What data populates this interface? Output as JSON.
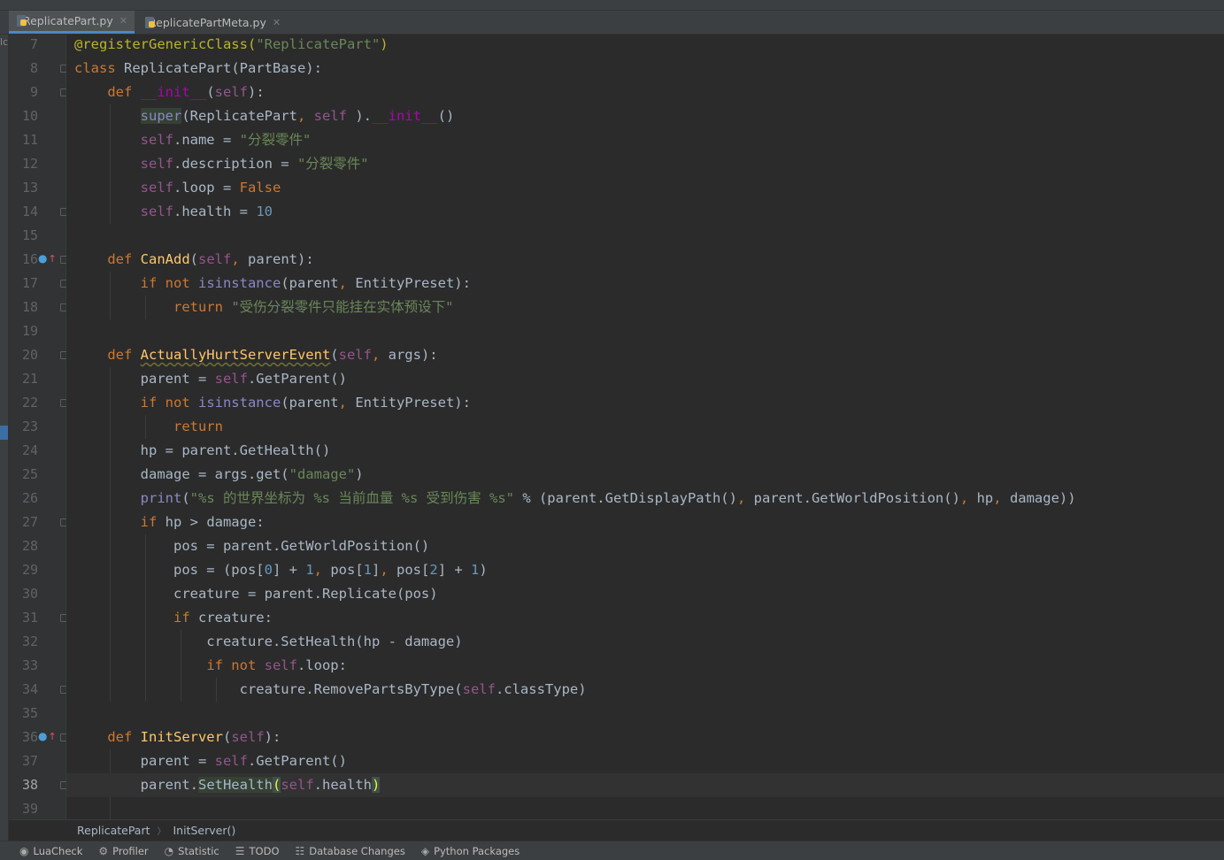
{
  "tabs": [
    {
      "label": "ReplicatePart.py",
      "active": true
    },
    {
      "label": "ReplicatePartMeta.py",
      "active": false
    }
  ],
  "left_strip_label": "lc",
  "breadcrumb": [
    "ReplicatePart",
    "InitServer()"
  ],
  "status_items": [
    {
      "label": "LuaCheck",
      "icon": "luacheck-icon"
    },
    {
      "label": "Profiler",
      "icon": "profiler-icon"
    },
    {
      "label": "Statistic",
      "icon": "statistic-icon"
    },
    {
      "label": "TODO",
      "icon": "todo-list-icon"
    },
    {
      "label": "Database Changes",
      "icon": "database-icon"
    },
    {
      "label": "Python Packages",
      "icon": "packages-icon"
    }
  ],
  "current_line": 38,
  "lines": [
    {
      "n": 7,
      "t": [
        [
          "dec",
          "@registerGenericClass("
        ],
        [
          "str",
          "\"ReplicatePart\""
        ],
        [
          "dec",
          ")"
        ]
      ]
    },
    {
      "n": 8,
      "t": [
        [
          "kw",
          "class "
        ],
        [
          "",
          "ReplicatePart(PartBase):"
        ]
      ]
    },
    {
      "n": 9,
      "t": [
        [
          "",
          "    "
        ],
        [
          "kw",
          "def "
        ],
        [
          "mag",
          "__init__"
        ],
        [
          "",
          "("
        ],
        [
          "slf",
          "self"
        ],
        [
          "",
          "):"
        ]
      ]
    },
    {
      "n": 10,
      "t": [
        [
          "",
          "        "
        ],
        [
          "bi hl",
          "super"
        ],
        [
          "",
          "(ReplicatePart"
        ],
        [
          "kw",
          ", "
        ],
        [
          "slf",
          "self"
        ],
        [
          "",
          " )."
        ],
        [
          "mag",
          "__init__"
        ],
        [
          "",
          "()"
        ]
      ]
    },
    {
      "n": 11,
      "t": [
        [
          "",
          "        "
        ],
        [
          "slf",
          "self"
        ],
        [
          "",
          ".name = "
        ],
        [
          "str",
          "\"分裂零件\""
        ]
      ]
    },
    {
      "n": 12,
      "t": [
        [
          "",
          "        "
        ],
        [
          "slf",
          "self"
        ],
        [
          "",
          ".description = "
        ],
        [
          "str",
          "\"分裂零件\""
        ]
      ]
    },
    {
      "n": 13,
      "t": [
        [
          "",
          "        "
        ],
        [
          "slf",
          "self"
        ],
        [
          "",
          ".loop = "
        ],
        [
          "kw",
          "False"
        ]
      ]
    },
    {
      "n": 14,
      "t": [
        [
          "",
          "        "
        ],
        [
          "slf",
          "self"
        ],
        [
          "",
          ".health = "
        ],
        [
          "num",
          "10"
        ]
      ]
    },
    {
      "n": 15,
      "t": []
    },
    {
      "n": 16,
      "t": [
        [
          "",
          "    "
        ],
        [
          "kw",
          "def "
        ],
        [
          "fn",
          "CanAdd"
        ],
        [
          "",
          "("
        ],
        [
          "slf",
          "self"
        ],
        [
          "kw",
          ", "
        ],
        [
          "",
          "parent):"
        ]
      ]
    },
    {
      "n": 17,
      "t": [
        [
          "",
          "        "
        ],
        [
          "kw",
          "if not "
        ],
        [
          "bi",
          "isinstance"
        ],
        [
          "",
          "(parent"
        ],
        [
          "kw",
          ", "
        ],
        [
          "",
          "EntityPreset):"
        ]
      ]
    },
    {
      "n": 18,
      "t": [
        [
          "",
          "            "
        ],
        [
          "kw",
          "return "
        ],
        [
          "str",
          "\"受伤分裂零件只能挂在实体预设下\""
        ]
      ]
    },
    {
      "n": 19,
      "t": []
    },
    {
      "n": 20,
      "t": [
        [
          "",
          "    "
        ],
        [
          "kw",
          "def "
        ],
        [
          "fn wav",
          "ActuallyHurtServerEvent"
        ],
        [
          "",
          "("
        ],
        [
          "slf",
          "self"
        ],
        [
          "kw",
          ", "
        ],
        [
          "",
          "args):"
        ]
      ]
    },
    {
      "n": 21,
      "t": [
        [
          "",
          "        parent = "
        ],
        [
          "slf",
          "self"
        ],
        [
          "",
          ".GetParent()"
        ]
      ]
    },
    {
      "n": 22,
      "t": [
        [
          "",
          "        "
        ],
        [
          "kw",
          "if not "
        ],
        [
          "bi",
          "isinstance"
        ],
        [
          "",
          "(parent"
        ],
        [
          "kw",
          ", "
        ],
        [
          "",
          "EntityPreset):"
        ]
      ]
    },
    {
      "n": 23,
      "t": [
        [
          "",
          "            "
        ],
        [
          "kw",
          "return"
        ]
      ]
    },
    {
      "n": 24,
      "t": [
        [
          "",
          "        hp = parent.GetHealth()"
        ]
      ]
    },
    {
      "n": 25,
      "t": [
        [
          "",
          "        damage = args.get("
        ],
        [
          "str",
          "\"damage\""
        ],
        [
          "",
          ")"
        ]
      ]
    },
    {
      "n": 26,
      "t": [
        [
          "",
          "        "
        ],
        [
          "bi",
          "print"
        ],
        [
          "",
          "("
        ],
        [
          "str",
          "\"%s 的世界坐标为 %s 当前血量 %s 受到伤害 %s\""
        ],
        [
          "",
          " % (parent.GetDisplayPath()"
        ],
        [
          "kw",
          ", "
        ],
        [
          "",
          "parent.GetWorldPosition()"
        ],
        [
          "kw",
          ", "
        ],
        [
          "",
          "hp"
        ],
        [
          "kw",
          ", "
        ],
        [
          "",
          "damage))"
        ]
      ]
    },
    {
      "n": 27,
      "t": [
        [
          "",
          "        "
        ],
        [
          "kw",
          "if "
        ],
        [
          "",
          "hp > damage:"
        ]
      ]
    },
    {
      "n": 28,
      "t": [
        [
          "",
          "            pos = parent.GetWorldPosition()"
        ]
      ]
    },
    {
      "n": 29,
      "t": [
        [
          "",
          "            pos = (pos["
        ],
        [
          "num",
          "0"
        ],
        [
          "",
          "] + "
        ],
        [
          "num",
          "1"
        ],
        [
          "kw",
          ", "
        ],
        [
          "",
          "pos["
        ],
        [
          "num",
          "1"
        ],
        [
          "",
          "]"
        ],
        [
          "kw",
          ", "
        ],
        [
          "",
          "pos["
        ],
        [
          "num",
          "2"
        ],
        [
          "",
          "] + "
        ],
        [
          "num",
          "1"
        ],
        [
          "",
          ")"
        ]
      ]
    },
    {
      "n": 30,
      "t": [
        [
          "",
          "            creature = parent.Replicate(pos)"
        ]
      ]
    },
    {
      "n": 31,
      "t": [
        [
          "",
          "            "
        ],
        [
          "kw",
          "if "
        ],
        [
          "",
          "creature:"
        ]
      ]
    },
    {
      "n": 32,
      "t": [
        [
          "",
          "                creature.SetHealth(hp - damage)"
        ]
      ]
    },
    {
      "n": 33,
      "t": [
        [
          "",
          "                "
        ],
        [
          "kw",
          "if not "
        ],
        [
          "slf",
          "self"
        ],
        [
          "",
          ".loop:"
        ]
      ]
    },
    {
      "n": 34,
      "t": [
        [
          "",
          "                    creature.RemovePartsByType("
        ],
        [
          "slf",
          "self"
        ],
        [
          "",
          ".classType)"
        ]
      ]
    },
    {
      "n": 35,
      "t": []
    },
    {
      "n": 36,
      "t": [
        [
          "",
          "    "
        ],
        [
          "kw",
          "def "
        ],
        [
          "fn",
          "InitServer"
        ],
        [
          "",
          "("
        ],
        [
          "slf",
          "self"
        ],
        [
          "",
          "):"
        ]
      ]
    },
    {
      "n": 37,
      "t": [
        [
          "",
          "        parent = "
        ],
        [
          "slf",
          "self"
        ],
        [
          "",
          ".GetParent()"
        ]
      ]
    },
    {
      "n": 38,
      "t": [
        [
          "",
          "        parent."
        ],
        [
          "hl",
          "SetHealth"
        ],
        [
          "brace",
          "("
        ],
        [
          "slf",
          "self"
        ],
        [
          "",
          ".health"
        ],
        [
          "brace",
          ")"
        ]
      ]
    },
    {
      "n": 39,
      "t": []
    }
  ],
  "override_markers": [
    16,
    36
  ],
  "fold_open": [
    8,
    9,
    16,
    17,
    20,
    22,
    27,
    31,
    36
  ],
  "fold_close": [
    14,
    18,
    34,
    38
  ]
}
